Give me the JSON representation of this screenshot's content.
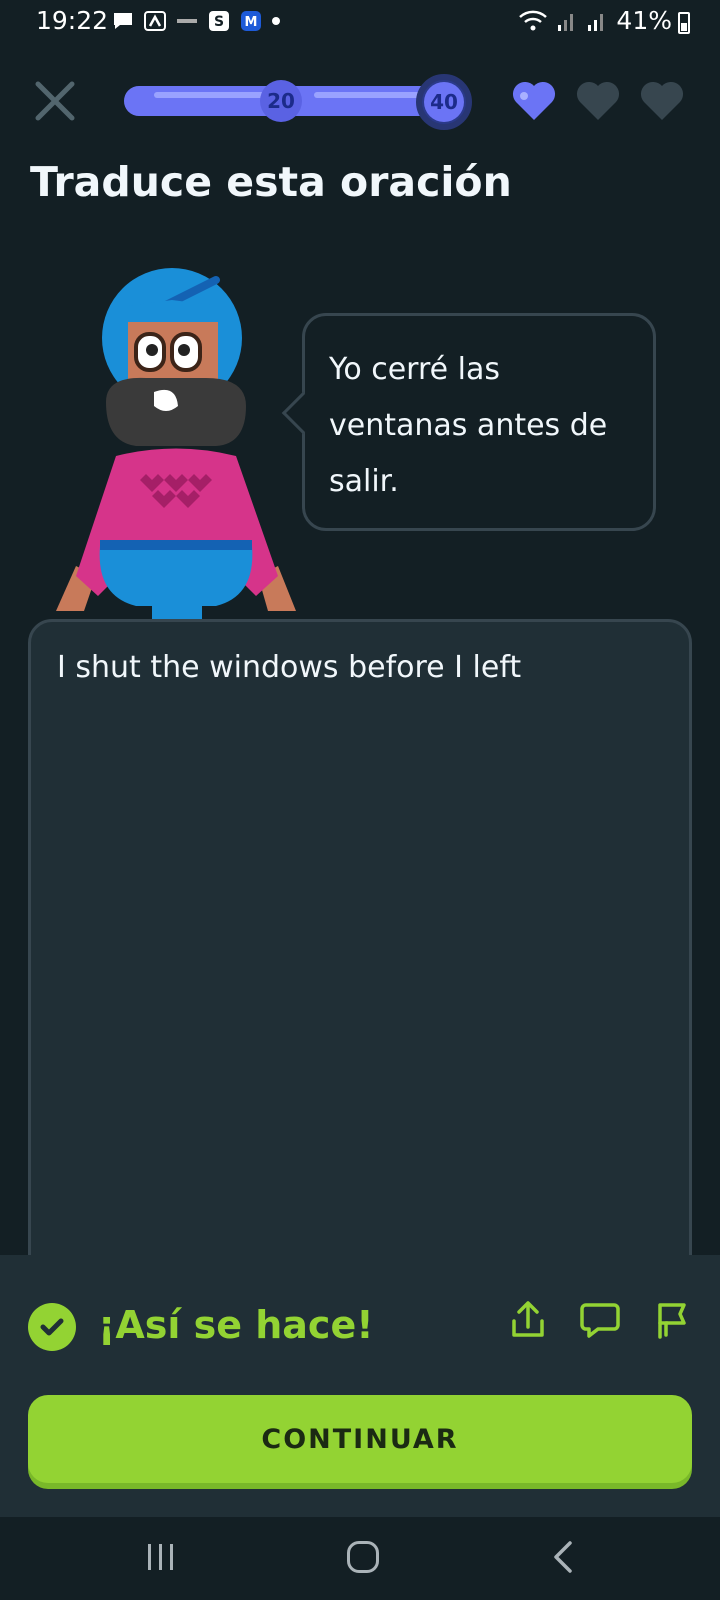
{
  "status_bar": {
    "time": "19:22",
    "battery": "41%",
    "left_icons": [
      "message-icon",
      "app-icon",
      "news-icon",
      "s-app-icon",
      "m-app-icon",
      "dot-icon"
    ],
    "right_icons": [
      "wifi-icon",
      "signal-icon",
      "signal-icon",
      "battery-icon"
    ]
  },
  "header": {
    "progress_milestones": [
      "20",
      "40"
    ],
    "progress_fraction": 1.0,
    "hearts_total": 3,
    "hearts_filled": 1
  },
  "prompt": {
    "title": "Traduce esta oración",
    "sentence": "Yo cerré las ventanas antes de salir."
  },
  "answer": {
    "text": "I shut the windows before I left"
  },
  "feedback": {
    "title": "¡Así se hace!",
    "continue_label": "CONTINUAR",
    "actions": [
      "share-icon",
      "comment-icon",
      "report-flag-icon"
    ]
  },
  "colors": {
    "background": "#131f24",
    "panel": "#202f36",
    "border": "#37464f",
    "success": "#93d333",
    "progress": "#6b74f5",
    "heart_active": "#6b74f5",
    "heart_inactive": "#37464f"
  }
}
